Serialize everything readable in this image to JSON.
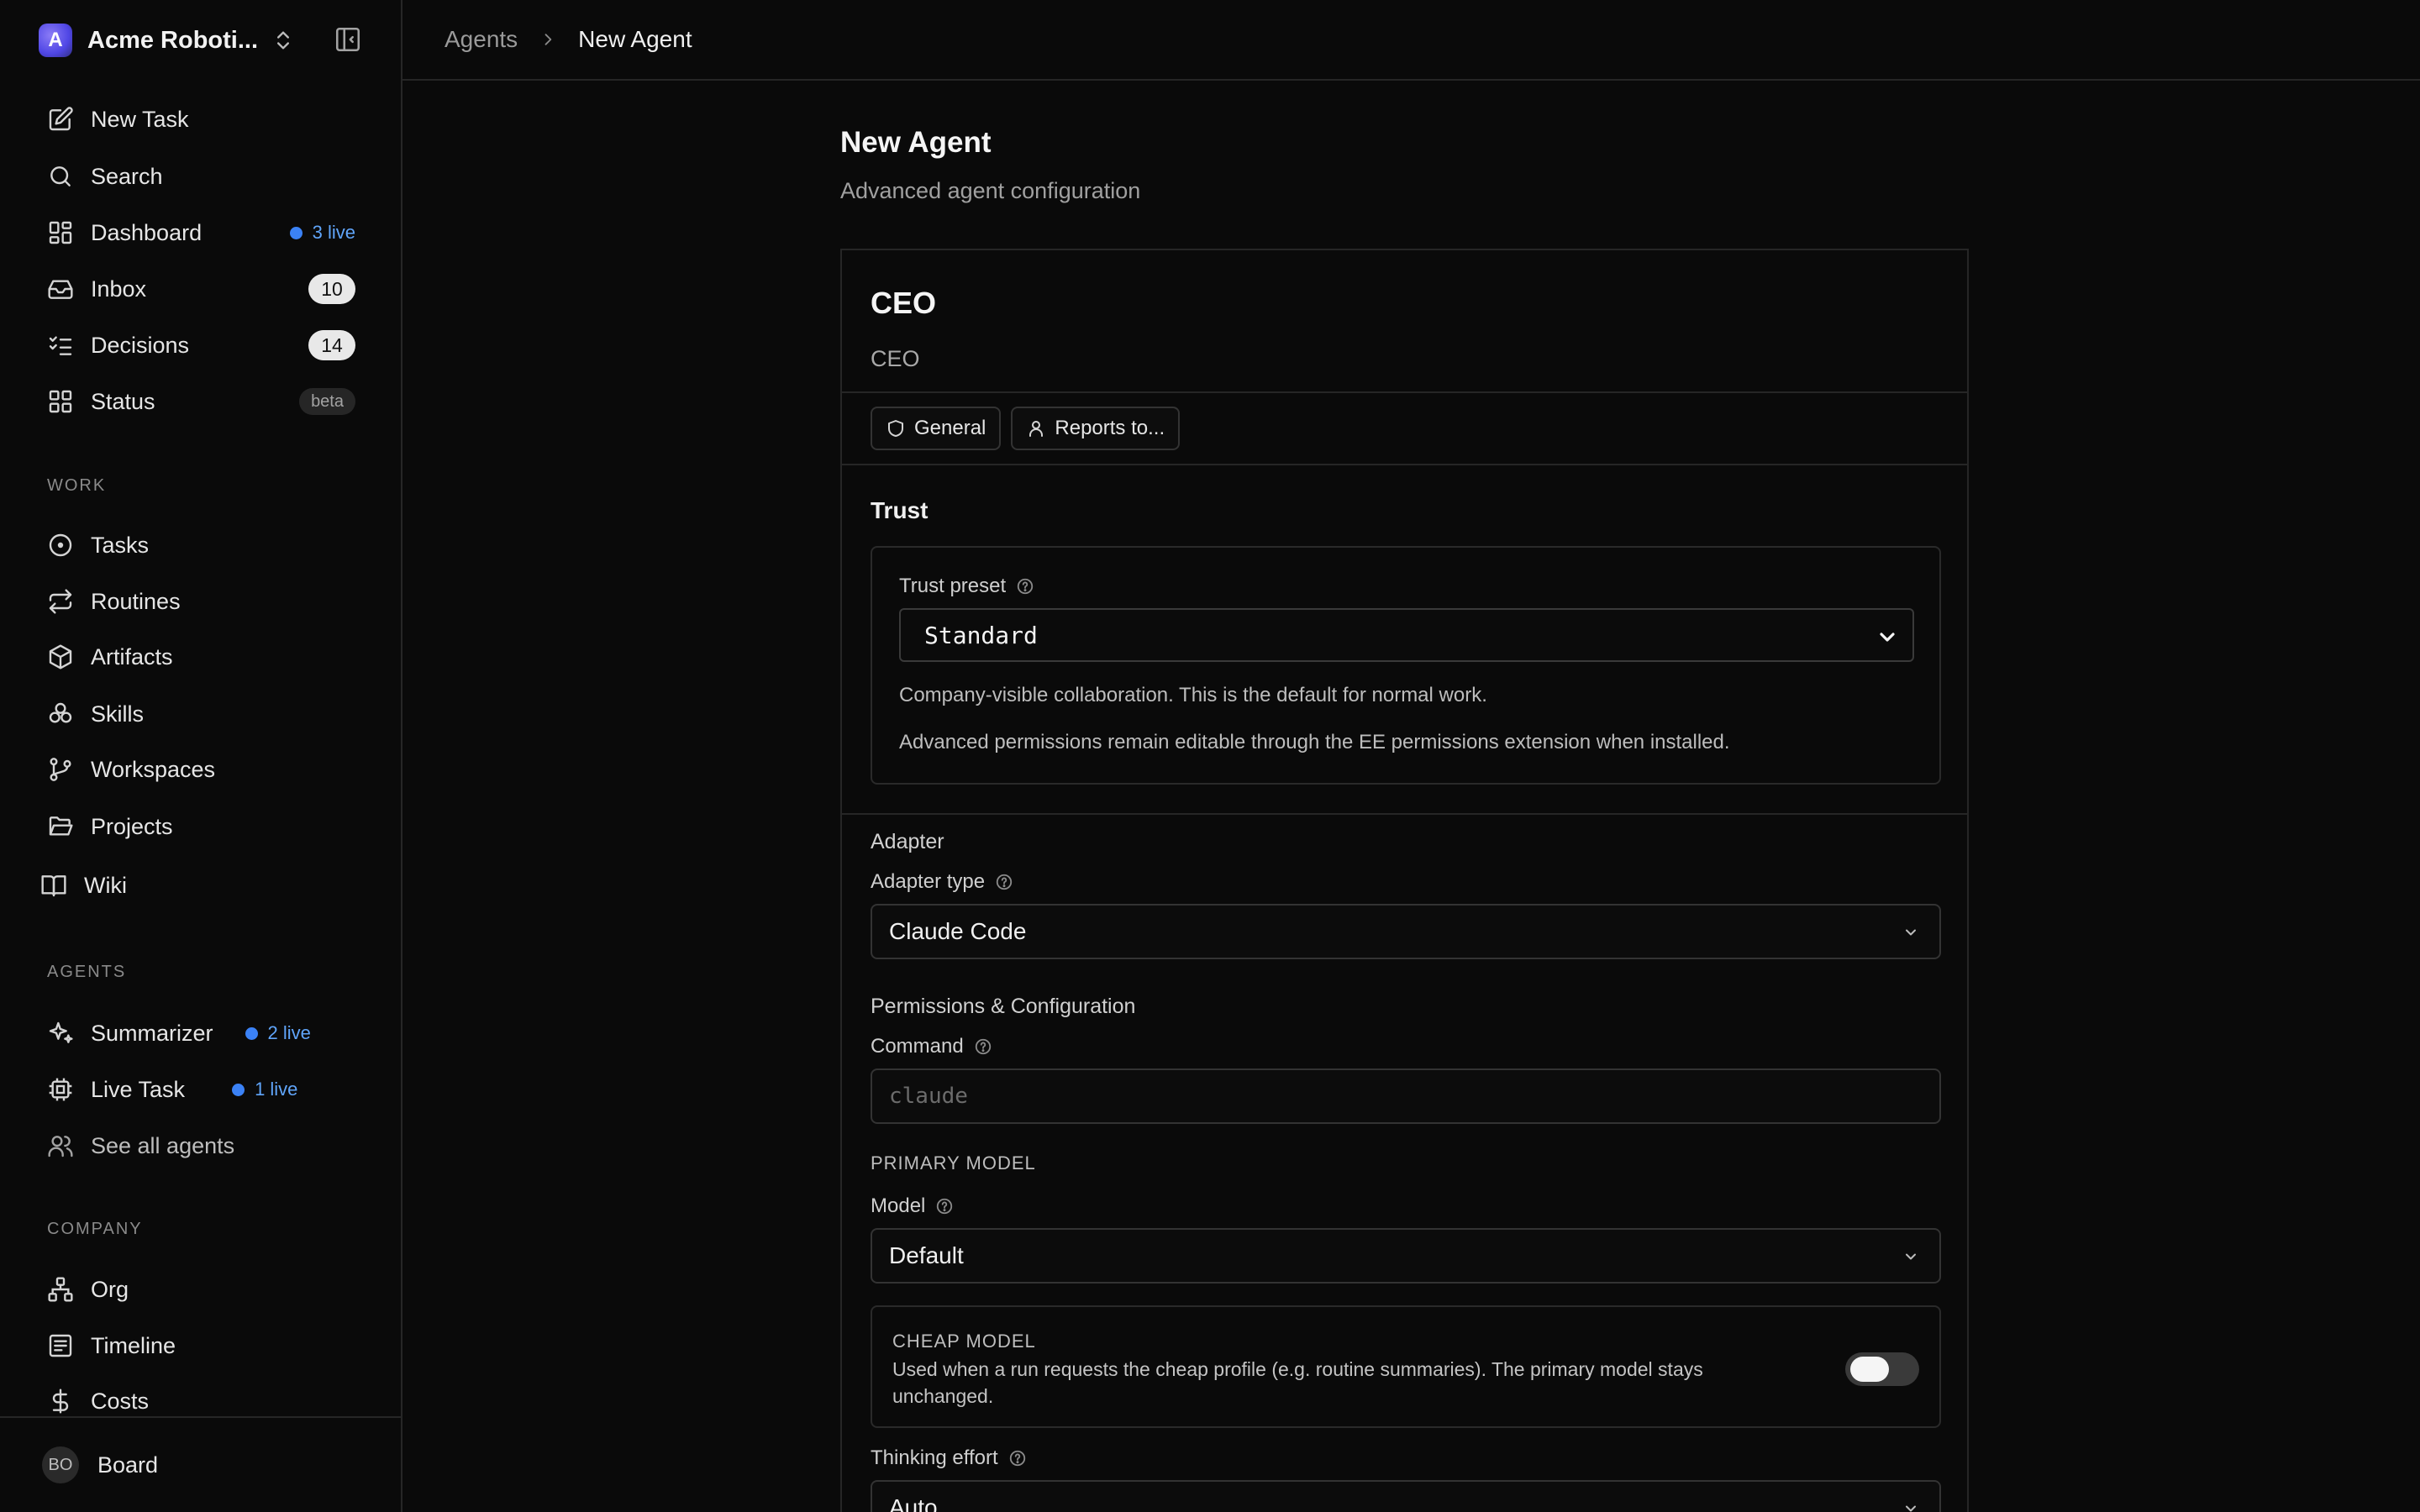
{
  "company": {
    "name": "Acme Roboti...",
    "initial": "A"
  },
  "nav": {
    "new_task": "New Task",
    "search": "Search",
    "dashboard": "Dashboard",
    "dashboard_live": "3 live",
    "inbox": "Inbox",
    "inbox_count": "10",
    "decisions": "Decisions",
    "decisions_count": "14",
    "status": "Status",
    "status_badge": "beta"
  },
  "sections": {
    "work": "WORK",
    "agents": "AGENTS",
    "company": "COMPANY"
  },
  "work": {
    "tasks": "Tasks",
    "routines": "Routines",
    "artifacts": "Artifacts",
    "skills": "Skills",
    "workspaces": "Workspaces",
    "projects": "Projects",
    "wiki": "Wiki"
  },
  "agents": {
    "summarizer": "Summarizer",
    "summarizer_live": "2 live",
    "live_task": "Live Task",
    "live_task_live": "1 live",
    "see_all": "See all agents"
  },
  "company_nav": {
    "org": "Org",
    "timeline": "Timeline",
    "costs": "Costs"
  },
  "user": {
    "initials": "BO",
    "name": "Board"
  },
  "breadcrumb": {
    "parent": "Agents",
    "current": "New Agent"
  },
  "page": {
    "title": "New Agent",
    "subtitle": "Advanced agent configuration"
  },
  "agent": {
    "name": "CEO",
    "title": "CEO"
  },
  "tabs": {
    "general": "General",
    "reports_to": "Reports to..."
  },
  "trust": {
    "heading": "Trust",
    "preset_label": "Trust preset",
    "preset_value": "Standard",
    "desc1": "Company-visible collaboration. This is the default for normal work.",
    "desc2": "Advanced permissions remain editable through the EE permissions extension when installed."
  },
  "adapter": {
    "heading": "Adapter",
    "type_label": "Adapter type",
    "type_value": "Claude Code",
    "perm_heading": "Permissions & Configuration",
    "command_label": "Command",
    "command_placeholder": "claude",
    "primary_model_heading": "PRIMARY MODEL",
    "model_label": "Model",
    "model_value": "Default",
    "cheap_model_heading": "CHEAP MODEL",
    "cheap_model_desc": "Used when a run requests the cheap profile (e.g. routine summaries). The primary model stays unchanged.",
    "cheap_model_enabled": false,
    "thinking_label": "Thinking effort",
    "thinking_value": "Auto"
  }
}
